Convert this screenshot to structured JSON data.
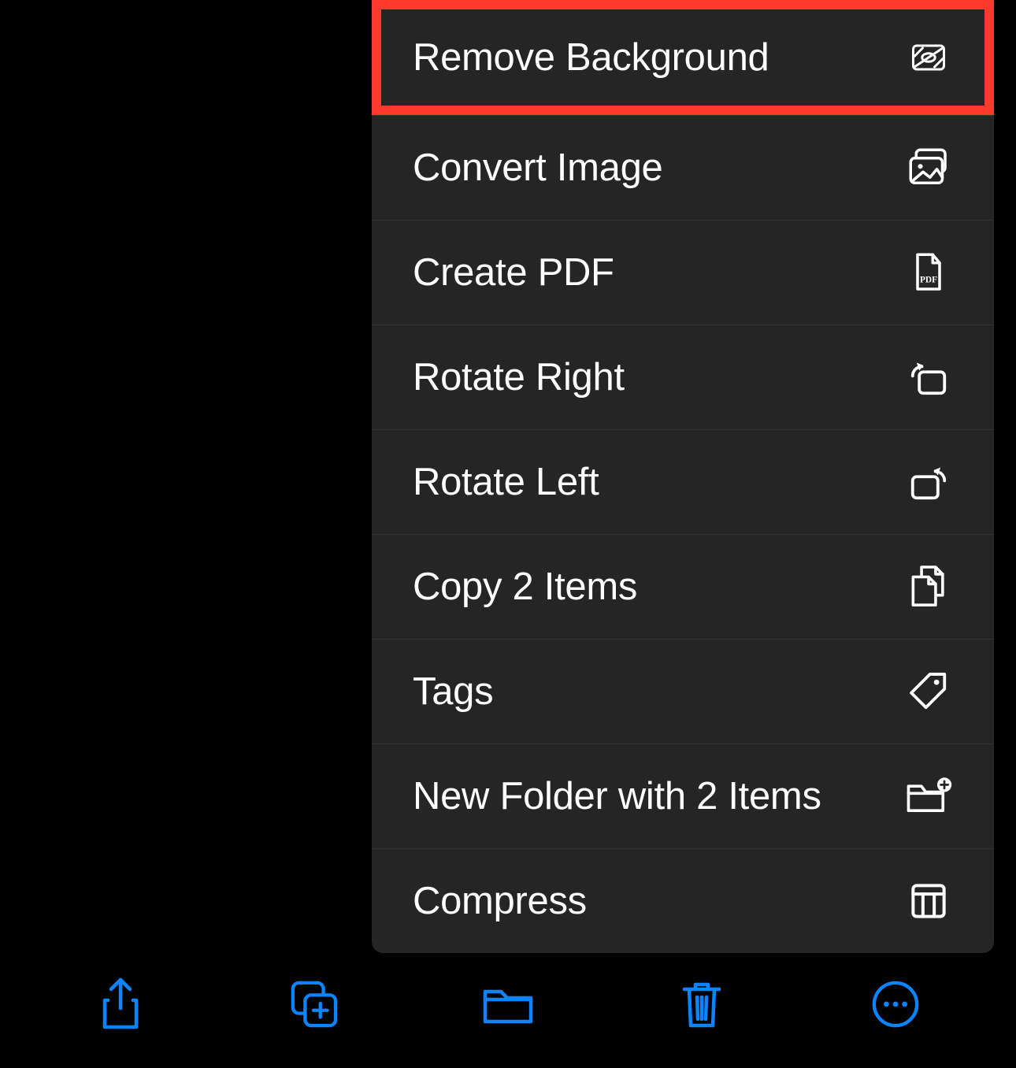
{
  "menu": {
    "items": [
      {
        "label": "Remove Background",
        "icon": "remove-background-icon",
        "highlighted": true
      },
      {
        "label": "Convert Image",
        "icon": "convert-image-icon"
      },
      {
        "label": "Create PDF",
        "icon": "create-pdf-icon"
      },
      {
        "label": "Rotate Right",
        "icon": "rotate-right-icon"
      },
      {
        "label": "Rotate Left",
        "icon": "rotate-left-icon"
      },
      {
        "label": "Copy 2 Items",
        "icon": "copy-items-icon"
      },
      {
        "label": "Tags",
        "icon": "tags-icon"
      },
      {
        "label": "New Folder with 2 Items",
        "icon": "new-folder-icon"
      },
      {
        "label": "Compress",
        "icon": "compress-icon"
      }
    ]
  },
  "toolbar": {
    "items": [
      {
        "icon": "share-icon"
      },
      {
        "icon": "duplicate-icon"
      },
      {
        "icon": "folder-icon"
      },
      {
        "icon": "trash-icon"
      },
      {
        "icon": "more-icon"
      }
    ]
  },
  "accent": "#0a84ff",
  "highlight": "#ff3a2d"
}
